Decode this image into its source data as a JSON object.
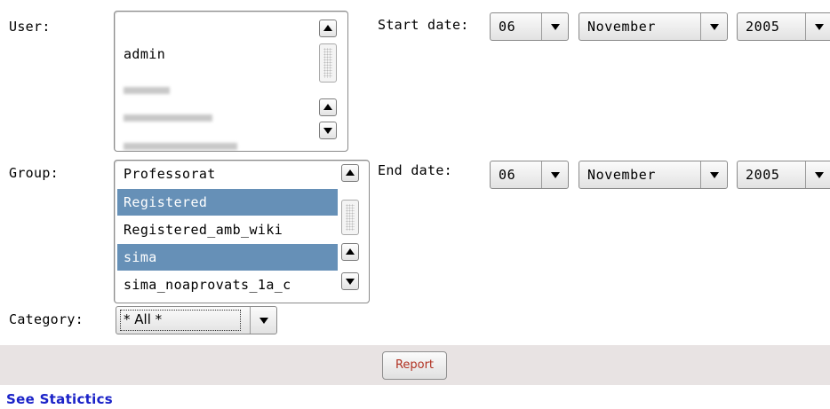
{
  "user": {
    "label": "User:",
    "items": [
      "admin"
    ]
  },
  "group": {
    "label": "Group:",
    "items": [
      {
        "label": "Professorat",
        "selected": false
      },
      {
        "label": "Registered",
        "selected": true
      },
      {
        "label": "Registered_amb_wiki",
        "selected": false
      },
      {
        "label": "sima",
        "selected": true
      },
      {
        "label": "sima_noaprovats_1a_c",
        "selected": false
      }
    ]
  },
  "category": {
    "label": "Category:",
    "value": "* All *"
  },
  "start_date": {
    "label": "Start date:",
    "day": "06",
    "month": "November",
    "year": "2005"
  },
  "end_date": {
    "label": "End date:",
    "day": "06",
    "month": "November",
    "year": "2005"
  },
  "report_button": "Report",
  "see_statistics_link": "See Statictics",
  "colors": {
    "selection": "#6690b7",
    "report_bar": "#e8e3e3",
    "link": "#1a22c8",
    "report_text": "#b03020"
  }
}
